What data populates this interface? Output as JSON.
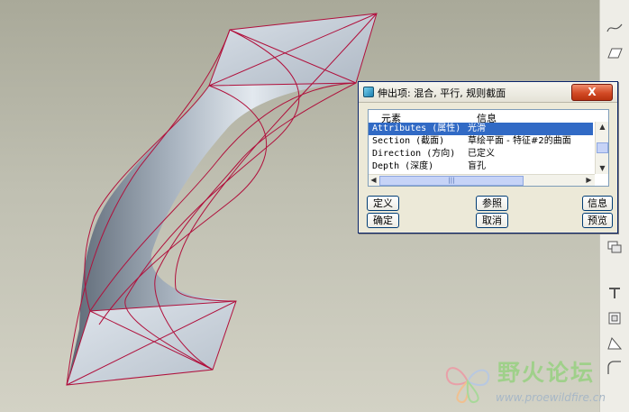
{
  "dialog": {
    "title": "伸出项: 混合, 平行, 规则截面",
    "close_label": "X",
    "list": {
      "columns": [
        "元素",
        "信息"
      ],
      "rows": [
        {
          "element": "Attributes (属性)",
          "info": "光滑",
          "selected": true
        },
        {
          "element": "Section (截面)",
          "info": "草绘平面 - 特征#2的曲面",
          "selected": false
        },
        {
          "element": "Direction (方向)",
          "info": "已定义",
          "selected": false
        },
        {
          "element": "Depth (深度)",
          "info": "盲孔",
          "selected": false
        }
      ]
    },
    "buttons": {
      "define": "定义",
      "refs": "参照",
      "info": "信息",
      "ok": "确定",
      "cancel": "取消",
      "preview": "预览"
    }
  },
  "watermark": {
    "name": "野火论坛",
    "url": "www.proewildfire.cn"
  },
  "toolbar": {
    "icons": [
      "sketch-curve-icon",
      "datum-plane-icon",
      "datum-axis-icon",
      "copy-geometry-icon",
      "rib-icon",
      "shell-icon",
      "draft-icon",
      "round-icon"
    ]
  },
  "colors": {
    "viewport_top": "#a9a999",
    "viewport_bottom": "#d3d2c5",
    "edge": "#b0103c",
    "selection": "#316ac5"
  }
}
